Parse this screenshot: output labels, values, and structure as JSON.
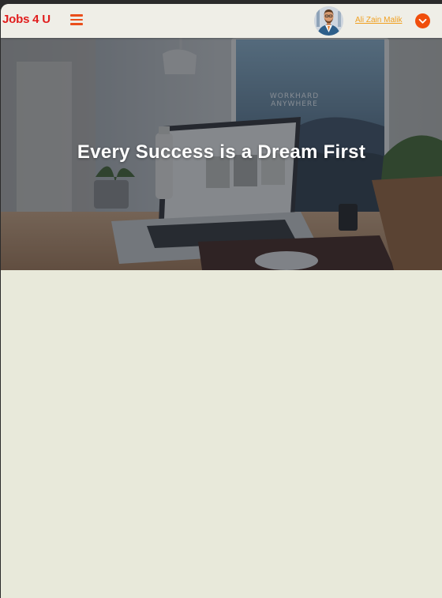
{
  "navbar": {
    "brand": "Jobs 4 U",
    "menu_icon": "hamburger-menu-icon",
    "user_name": "Ali Zain Malik",
    "dropdown_icon": "chevron-down-icon"
  },
  "hero": {
    "heading": "Every Success is a Dream First",
    "monitor_text": "WORKHARD ANYWHERE"
  },
  "colors": {
    "brand": "#e11d1d",
    "accent": "#f04e0c",
    "user_name": "#f0a020",
    "navbar_bg": "#efeee7",
    "page_bg": "#e8e9da"
  }
}
